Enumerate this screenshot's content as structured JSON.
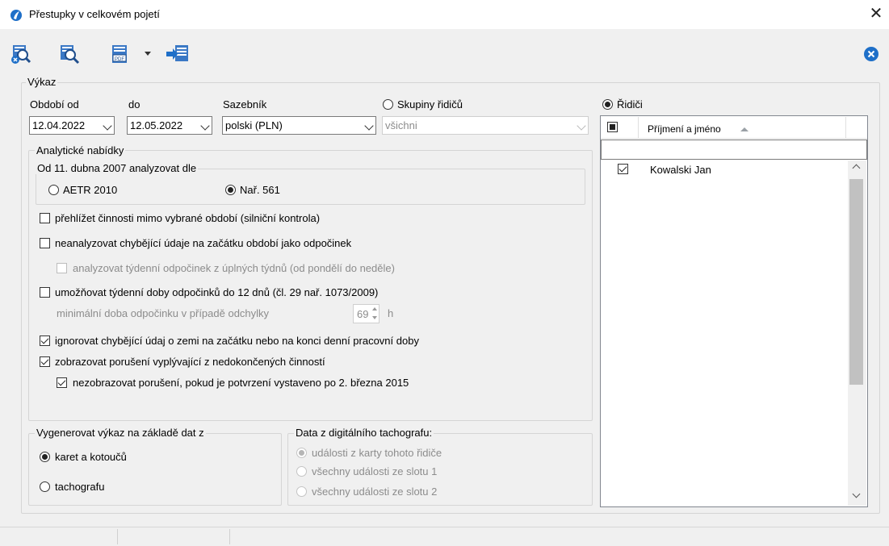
{
  "window": {
    "title": "Přestupky v celkovém pojetí"
  },
  "report_group": {
    "label": "Výkaz",
    "period_from": {
      "label": "Období od",
      "value": "12.04.2022"
    },
    "period_to": {
      "label": "do",
      "value": "12.05.2022"
    },
    "tariff": {
      "label": "Sazebník",
      "value": "polski (PLN)"
    },
    "driver_groups": {
      "label": "Skupiny řidičů",
      "value": "všichni",
      "selected": false
    },
    "drivers_radio": {
      "label": "Řidiči",
      "selected": true
    }
  },
  "analytic": {
    "label": "Analytické nabídky",
    "since_group": {
      "label": "Od 11. dubna 2007 analyzovat dle",
      "option_aetr": "AETR 2010",
      "option_nar": "Nař. 561",
      "selected": "Nař. 561"
    },
    "opt1": {
      "label": "přehlížet činnosti mimo vybrané období (silniční kontrola)",
      "checked": false
    },
    "opt2": {
      "label": "neanalyzovat chybějící údaje na začátku období jako odpočinek",
      "checked": false
    },
    "opt3": {
      "label": "analyzovat týdenní odpočinek z úplných týdnů (od pondělí do neděle)",
      "checked": false,
      "disabled": true
    },
    "opt4": {
      "label": "umožňovat týdenní doby odpočinků do 12 dnů (čl. 29 nař. 1073/2009)",
      "checked": false
    },
    "min_rest": {
      "label": "minimální doba odpočinku v případě odchylky",
      "value": "69",
      "unit": "h"
    },
    "opt5": {
      "label": "ignorovat chybějící údaj o zemi na začátku nebo na konci denní pracovní doby",
      "checked": true
    },
    "opt6": {
      "label": "zobrazovat porušení vyplývající z nedokončených činností",
      "checked": true
    },
    "opt7": {
      "label": "nezobrazovat porušení, pokud je potvrzení vystaveno po 2. března 2015",
      "checked": true
    }
  },
  "generate_group": {
    "label": "Vygenerovat výkaz na základě dat z",
    "option_cards": "karet a kotoučů",
    "option_tacho": "tachografu",
    "selected": "karet a kotoučů"
  },
  "digital_group": {
    "label": "Data z digitálního tachografu:",
    "options": [
      "události z karty tohoto řidiče",
      "všechny události ze slotu 1",
      "všechny události ze slotu 2"
    ],
    "selected": "události z karty tohoto řidiče"
  },
  "drivers_list": {
    "column_header": "Příjmení a jméno",
    "filter_value": "",
    "rows": [
      {
        "name": "Kowalski Jan",
        "checked": true
      }
    ]
  },
  "colors": {
    "accent": "#1e6fc8",
    "window_bg": "#f0f0f0",
    "disabled_text": "#8c8c8c"
  },
  "icons": [
    "app-logo-icon",
    "delete-report-icon",
    "preview-report-icon",
    "pdf-export-icon",
    "dropdown-arrow-icon",
    "email-send-icon",
    "close-circle-icon"
  ]
}
